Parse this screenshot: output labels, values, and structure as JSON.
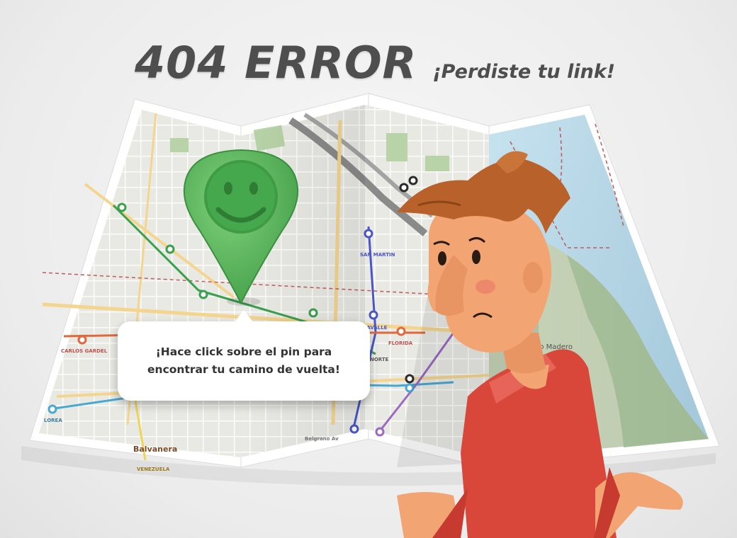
{
  "header": {
    "title": "404 ERROR",
    "subtitle": "¡Perdiste tu link!"
  },
  "tooltip": {
    "line1": "¡Hace click sobre el pin para",
    "line2": "encontrar tu camino de vuelta!"
  },
  "map": {
    "labels": {
      "san_martin": "SAN MARTIN",
      "lavalle": "LAVALLE",
      "florida": "FLORIDA",
      "norte": "NORTE",
      "carlos_gardel": "CARLOS GARDEL",
      "lorea": "LOREA",
      "balvanera": "Balvanera",
      "venezuela": "VENEZUELA",
      "puerto_madero": "Puerto Madero",
      "belgrano": "Belgrano Av"
    }
  },
  "colors": {
    "pin": "#4caf50",
    "pin_dark": "#2e7d32",
    "water": "#b9d9e9",
    "park": "#a7c8a0",
    "shirt": "#d9463a",
    "hair": "#b8612a",
    "skin": "#f2a472"
  },
  "icons": {
    "pin": "smiley-location-pin-icon"
  }
}
